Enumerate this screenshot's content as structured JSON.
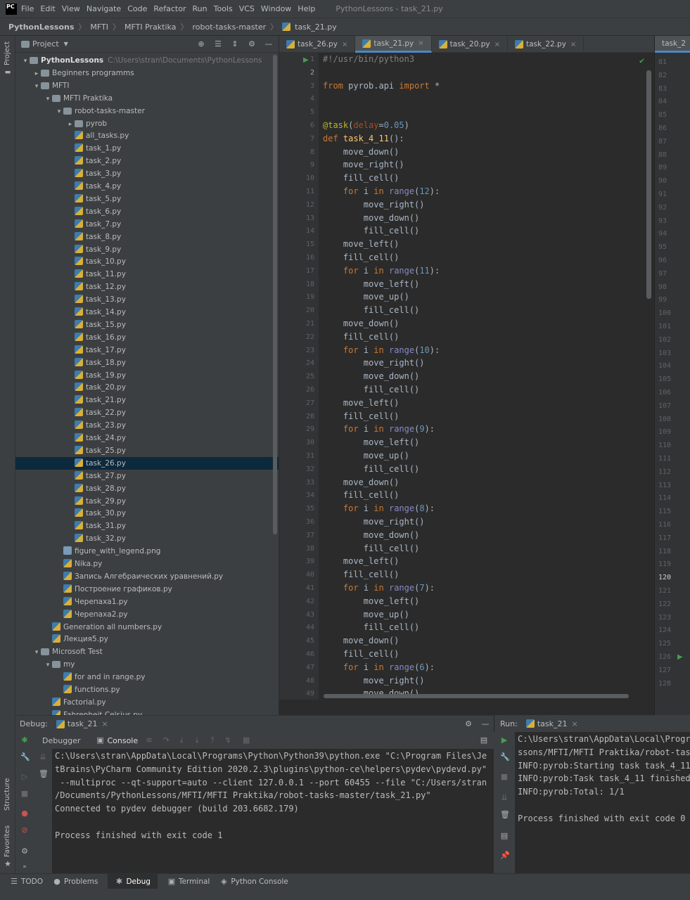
{
  "menu": {
    "logo": "PC",
    "items": [
      "File",
      "Edit",
      "View",
      "Navigate",
      "Code",
      "Refactor",
      "Run",
      "Tools",
      "VCS",
      "Window",
      "Help"
    ],
    "window_title": "PythonLessons - task_21.py"
  },
  "breadcrumb": [
    "PythonLessons",
    "MFTI",
    "MFTI Praktika",
    "robot-tasks-master",
    "task_21.py"
  ],
  "left_strip": {
    "project": "Project",
    "structure": "Structure",
    "favorites": "Favorites"
  },
  "project_panel": {
    "title": "Project"
  },
  "tree": [
    {
      "d": 0,
      "a": "▾",
      "t": "folder",
      "n": "PythonLessons",
      "extra": "C:\\Users\\stran\\Documents\\PythonLessons",
      "bold": true
    },
    {
      "d": 1,
      "a": "▸",
      "t": "folder",
      "n": "Beginners programms"
    },
    {
      "d": 1,
      "a": "▾",
      "t": "folder",
      "n": "MFTI"
    },
    {
      "d": 2,
      "a": "▾",
      "t": "folder",
      "n": "MFTI Praktika"
    },
    {
      "d": 3,
      "a": "▾",
      "t": "folder",
      "n": "robot-tasks-master"
    },
    {
      "d": 4,
      "a": "▸",
      "t": "folder",
      "n": "pyrob"
    },
    {
      "d": 4,
      "a": "",
      "t": "py",
      "n": "all_tasks.py"
    },
    {
      "d": 4,
      "a": "",
      "t": "py",
      "n": "task_1.py"
    },
    {
      "d": 4,
      "a": "",
      "t": "py",
      "n": "task_2.py"
    },
    {
      "d": 4,
      "a": "",
      "t": "py",
      "n": "task_3.py"
    },
    {
      "d": 4,
      "a": "",
      "t": "py",
      "n": "task_4.py"
    },
    {
      "d": 4,
      "a": "",
      "t": "py",
      "n": "task_5.py"
    },
    {
      "d": 4,
      "a": "",
      "t": "py",
      "n": "task_6.py"
    },
    {
      "d": 4,
      "a": "",
      "t": "py",
      "n": "task_7.py"
    },
    {
      "d": 4,
      "a": "",
      "t": "py",
      "n": "task_8.py"
    },
    {
      "d": 4,
      "a": "",
      "t": "py",
      "n": "task_9.py"
    },
    {
      "d": 4,
      "a": "",
      "t": "py",
      "n": "task_10.py"
    },
    {
      "d": 4,
      "a": "",
      "t": "py",
      "n": "task_11.py"
    },
    {
      "d": 4,
      "a": "",
      "t": "py",
      "n": "task_12.py"
    },
    {
      "d": 4,
      "a": "",
      "t": "py",
      "n": "task_13.py"
    },
    {
      "d": 4,
      "a": "",
      "t": "py",
      "n": "task_14.py"
    },
    {
      "d": 4,
      "a": "",
      "t": "py",
      "n": "task_15.py"
    },
    {
      "d": 4,
      "a": "",
      "t": "py",
      "n": "task_16.py"
    },
    {
      "d": 4,
      "a": "",
      "t": "py",
      "n": "task_17.py"
    },
    {
      "d": 4,
      "a": "",
      "t": "py",
      "n": "task_18.py"
    },
    {
      "d": 4,
      "a": "",
      "t": "py",
      "n": "task_19.py"
    },
    {
      "d": 4,
      "a": "",
      "t": "py",
      "n": "task_20.py"
    },
    {
      "d": 4,
      "a": "",
      "t": "py",
      "n": "task_21.py"
    },
    {
      "d": 4,
      "a": "",
      "t": "py",
      "n": "task_22.py"
    },
    {
      "d": 4,
      "a": "",
      "t": "py",
      "n": "task_23.py"
    },
    {
      "d": 4,
      "a": "",
      "t": "py",
      "n": "task_24.py"
    },
    {
      "d": 4,
      "a": "",
      "t": "py",
      "n": "task_25.py"
    },
    {
      "d": 4,
      "a": "",
      "t": "py",
      "n": "task_26.py",
      "sel": true
    },
    {
      "d": 4,
      "a": "",
      "t": "py",
      "n": "task_27.py"
    },
    {
      "d": 4,
      "a": "",
      "t": "py",
      "n": "task_28.py"
    },
    {
      "d": 4,
      "a": "",
      "t": "py",
      "n": "task_29.py"
    },
    {
      "d": 4,
      "a": "",
      "t": "py",
      "n": "task_30.py"
    },
    {
      "d": 4,
      "a": "",
      "t": "py",
      "n": "task_31.py"
    },
    {
      "d": 4,
      "a": "",
      "t": "py",
      "n": "task_32.py"
    },
    {
      "d": 3,
      "a": "",
      "t": "png",
      "n": "figure_with_legend.png"
    },
    {
      "d": 3,
      "a": "",
      "t": "py",
      "n": "Nika.py"
    },
    {
      "d": 3,
      "a": "",
      "t": "py",
      "n": "Запись Алгебраических уравнений.py"
    },
    {
      "d": 3,
      "a": "",
      "t": "py",
      "n": "Построение графиков.py"
    },
    {
      "d": 3,
      "a": "",
      "t": "py",
      "n": "Черепаха1.py"
    },
    {
      "d": 3,
      "a": "",
      "t": "py",
      "n": "Черепаха2.py"
    },
    {
      "d": 2,
      "a": "",
      "t": "py",
      "n": "Generation all numbers.py"
    },
    {
      "d": 2,
      "a": "",
      "t": "py",
      "n": "Лекция5.py"
    },
    {
      "d": 1,
      "a": "▾",
      "t": "folder",
      "n": "Microsoft Test"
    },
    {
      "d": 2,
      "a": "▾",
      "t": "folder",
      "n": "my"
    },
    {
      "d": 3,
      "a": "",
      "t": "py",
      "n": "for and in range.py"
    },
    {
      "d": 3,
      "a": "",
      "t": "py",
      "n": "functions.py"
    },
    {
      "d": 2,
      "a": "",
      "t": "py",
      "n": "Factorial.py"
    },
    {
      "d": 2,
      "a": "",
      "t": "py",
      "n": "Fahrenheit Celsius.py"
    }
  ],
  "editor_tabs": [
    {
      "label": "task_26.py"
    },
    {
      "label": "task_21.py",
      "active": true
    },
    {
      "label": "task_20.py"
    },
    {
      "label": "task_22.py"
    }
  ],
  "right_tab": "task_2",
  "code": [
    "#!/usr/bin/python3",
    "",
    "from pyrob.api import *",
    "",
    "",
    "@task(delay=0.05)",
    "def task_4_11():",
    "    move_down()",
    "    move_right()",
    "    fill_cell()",
    "    for i in range(12):",
    "        move_right()",
    "        move_down()",
    "        fill_cell()",
    "    move_left()",
    "    fill_cell()",
    "    for i in range(11):",
    "        move_left()",
    "        move_up()",
    "        fill_cell()",
    "    move_down()",
    "    fill_cell()",
    "    for i in range(10):",
    "        move_right()",
    "        move_down()",
    "        fill_cell()",
    "    move_left()",
    "    fill_cell()",
    "    for i in range(9):",
    "        move_left()",
    "        move_up()",
    "        fill_cell()",
    "    move_down()",
    "    fill_cell()",
    "    for i in range(8):",
    "        move_right()",
    "        move_down()",
    "        fill_cell()",
    "    move_left()",
    "    fill_cell()",
    "    for i in range(7):",
    "        move_left()",
    "        move_up()",
    "        fill_cell()",
    "    move_down()",
    "    fill_cell()",
    "    for i in range(6):",
    "        move_right()",
    "        move_down()"
  ],
  "right_lines": {
    "start": 81,
    "end": 128,
    "current": 120
  },
  "debug": {
    "label": "Debug:",
    "tab": "task_21",
    "debugger": "Debugger",
    "console": "Console",
    "lines": [
      "C:\\Users\\stran\\AppData\\Local\\Programs\\Python\\Python39\\python.exe \"C:\\Program Files\\Je",
      "tBrains\\PyCharm Community Edition 2020.2.3\\plugins\\python-ce\\helpers\\pydev\\pydevd.py\"",
      " --multiproc --qt-support=auto --client 127.0.0.1 --port 60455 --file \"C:/Users/stran",
      "/Documents/PythonLessons/MFTI/MFTI Praktika/robot-tasks-master/task_21.py\"",
      "Connected to pydev debugger (build 203.6682.179)",
      "",
      "Process finished with exit code 1"
    ]
  },
  "run": {
    "label": "Run:",
    "tab": "task_21",
    "lines": [
      "C:\\Users\\stran\\AppData\\Local\\Progra",
      "ssons/MFTI/MFTI Praktika/robot-task",
      "INFO:pyrob:Starting task task_4_11",
      "INFO:pyrob:Task task_4_11 finished",
      "INFO:pyrob:Total: 1/1",
      "",
      "Process finished with exit code 0"
    ]
  },
  "status": [
    {
      "icon": "☰",
      "label": "TODO"
    },
    {
      "icon": "●",
      "label": "Problems"
    },
    {
      "icon": "✱",
      "label": "Debug",
      "active": true
    },
    {
      "icon": "▣",
      "label": "Terminal"
    },
    {
      "icon": "◈",
      "label": "Python Console"
    }
  ],
  "colors": {
    "keyword": "#cc7832",
    "decorator": "#bbb529",
    "param": "#aa4926",
    "number": "#6897bb",
    "func": "#ffc66d",
    "comment": "#808080",
    "run_green": "#499c54",
    "debug_red": "#c75450"
  }
}
